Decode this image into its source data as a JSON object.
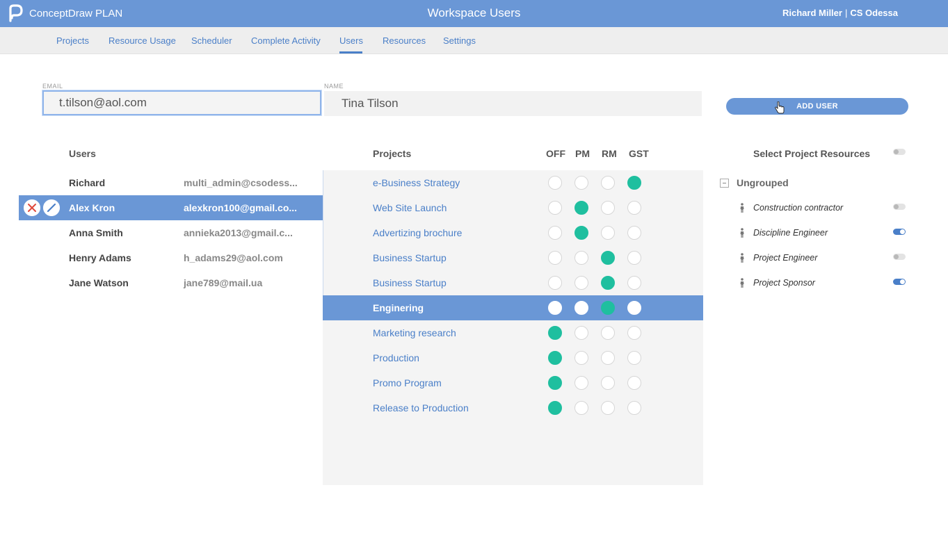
{
  "app": {
    "brand_name": "ConceptDraw",
    "brand_product": "PLAN",
    "window_title": "Workspace Users",
    "user_name": "Richard Miller",
    "separator": "|",
    "org_name": "CS Odessa"
  },
  "nav": {
    "items": [
      "Projects",
      "Resource Usage",
      "Scheduler",
      "Complete Activity",
      "Users",
      "Resources",
      "Settings"
    ],
    "active": "Users"
  },
  "form": {
    "email_label": "EMAIL",
    "email_value": "t.tilson@aol.com",
    "name_label": "NAME",
    "name_value": "Tina Tilson",
    "add_button": "ADD USER"
  },
  "users": {
    "header": "Users",
    "rows": [
      {
        "name": "Richard",
        "email": "multi_admin@csodess..."
      },
      {
        "name": "Alex Kron",
        "email": "alexkron100@gmail.co..."
      },
      {
        "name": "Anna Smith",
        "email": "annieka2013@gmail.c..."
      },
      {
        "name": "Henry Adams",
        "email": "h_adams29@aol.com"
      },
      {
        "name": "Jane Watson",
        "email": "jane789@mail.ua"
      }
    ],
    "selected": "Alex Kron"
  },
  "projects": {
    "header": "Projects",
    "role_columns": [
      "OFF",
      "PM",
      "RM",
      "GST"
    ],
    "rows": [
      {
        "name": "e-Business Strategy",
        "role": "GST"
      },
      {
        "name": "Web Site Launch",
        "role": "PM"
      },
      {
        "name": "Advertizing brochure",
        "role": "PM"
      },
      {
        "name": "Business Startup",
        "role": "RM"
      },
      {
        "name": "Business Startup",
        "role": "RM"
      },
      {
        "name": "Enginering",
        "role": "RM"
      },
      {
        "name": "Marketing research",
        "role": "OFF"
      },
      {
        "name": "Production",
        "role": "OFF"
      },
      {
        "name": "Promo Program",
        "role": "OFF"
      },
      {
        "name": "Release to Production",
        "role": "OFF"
      }
    ],
    "selected": "Enginering"
  },
  "resources": {
    "header": "Select Project Resources",
    "select_all": false,
    "group": "Ungrouped",
    "items": [
      {
        "name": "Construction contractor",
        "enabled": false
      },
      {
        "name": "Discipline Engineer",
        "enabled": true
      },
      {
        "name": "Project Engineer",
        "enabled": false
      },
      {
        "name": "Project Sponsor",
        "enabled": true
      }
    ]
  },
  "colors": {
    "accent": "#6a97d6",
    "link": "#4a7fc8",
    "role_on": "#1fbf9f",
    "delete": "#e0483c"
  }
}
